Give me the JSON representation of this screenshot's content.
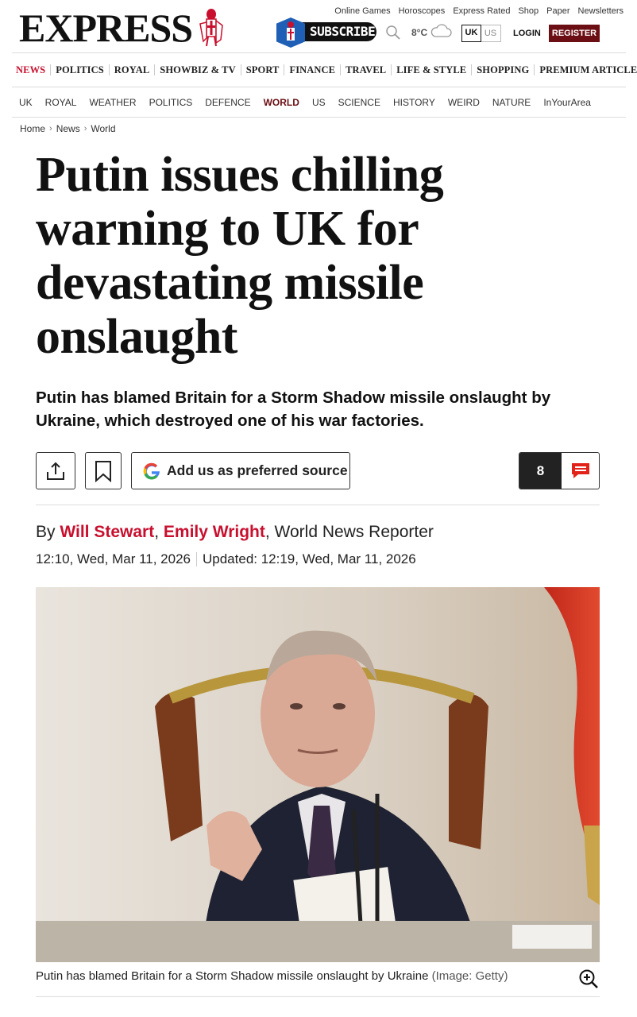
{
  "brand": {
    "logo": "EXPRESS",
    "accent": "#c8102e",
    "dark_red": "#6b0f14"
  },
  "top_links": [
    "Online Games",
    "Horoscopes",
    "Express Rated",
    "Shop",
    "Paper",
    "Newsletters"
  ],
  "header": {
    "subscribe_label": "SUBSCRIBE",
    "temperature": "8°C",
    "weather_icon": "cloud-icon",
    "region_options": [
      "UK",
      "US"
    ],
    "region_selected": "UK",
    "login_label": "LOGIN",
    "register_label": "REGISTER"
  },
  "nav_main": [
    "NEWS",
    "POLITICS",
    "ROYAL",
    "SHOWBIZ & TV",
    "SPORT",
    "FINANCE",
    "TRAVEL",
    "LIFE & STYLE",
    "SHOPPING",
    "PREMIUM ARTICLES"
  ],
  "nav_sub": [
    "UK",
    "ROYAL",
    "WEATHER",
    "POLITICS",
    "DEFENCE",
    "WORLD",
    "US",
    "SCIENCE",
    "HISTORY",
    "WEIRD",
    "NATURE",
    "InYourArea"
  ],
  "nav_sub_active": "WORLD",
  "breadcrumb": [
    "Home",
    "News",
    "World"
  ],
  "article": {
    "headline": "Putin issues chilling warning to UK for devastating missile onslaught",
    "standfirst": "Putin has blamed Britain for a Storm Shadow missile onslaught by Ukraine, which destroyed one of his war factories.",
    "preferred_source_label": "Add us as preferred source",
    "comment_count": "8",
    "byline_prefix": "By",
    "authors": [
      "Will Stewart",
      "Emily Wright"
    ],
    "author_role": "World News Reporter",
    "published": "12:10, Wed, Mar 11, 2026",
    "updated": "Updated: 12:19, Wed, Mar 11, 2026",
    "image_caption": "Putin has blamed Britain for a Storm Shadow missile onslaught by Ukraine",
    "image_credit": "(Image: Getty)"
  }
}
